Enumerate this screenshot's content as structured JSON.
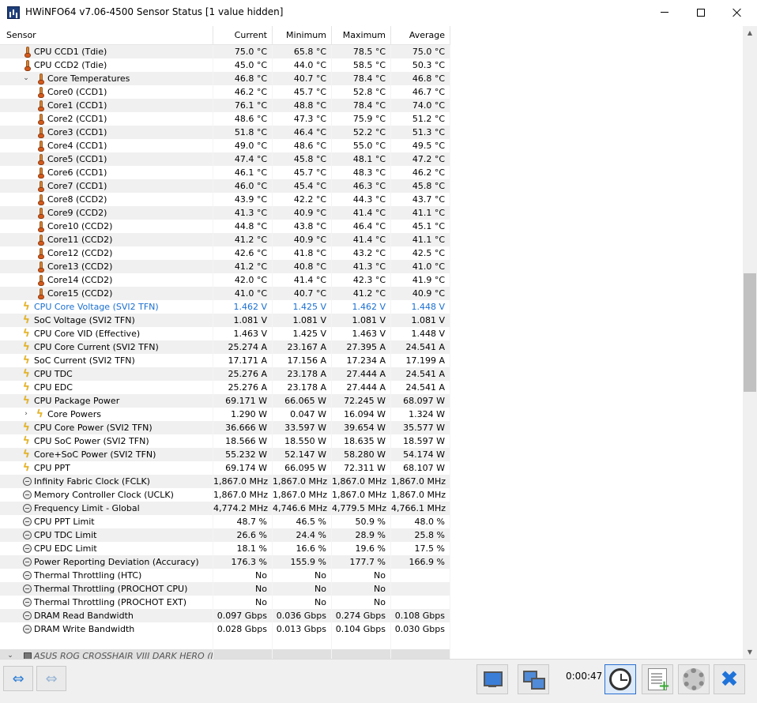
{
  "window": {
    "title": "HWiNFO64 v7.06-4500 Sensor Status [1 value hidden]"
  },
  "columns": {
    "sensor": "Sensor",
    "current": "Current",
    "minimum": "Minimum",
    "maximum": "Maximum",
    "average": "Average"
  },
  "rows": [
    {
      "icon": "thermometer",
      "indent": 1,
      "label": "CPU CCD1 (Tdie)",
      "cur": "75.0 °C",
      "min": "65.8 °C",
      "max": "78.5 °C",
      "avg": "75.0 °C"
    },
    {
      "icon": "thermometer",
      "indent": 1,
      "label": "CPU CCD2 (Tdie)",
      "cur": "45.0 °C",
      "min": "44.0 °C",
      "max": "58.5 °C",
      "avg": "50.3 °C"
    },
    {
      "icon": "thermometer",
      "indent": 2,
      "expander": "v",
      "label": "Core Temperatures",
      "cur": "46.8 °C",
      "min": "40.7 °C",
      "max": "78.4 °C",
      "avg": "46.8 °C"
    },
    {
      "icon": "thermometer",
      "indent": 2,
      "label": "Core0 (CCD1)",
      "cur": "46.2 °C",
      "min": "45.7 °C",
      "max": "52.8 °C",
      "avg": "46.7 °C"
    },
    {
      "icon": "thermometer",
      "indent": 2,
      "label": "Core1 (CCD1)",
      "cur": "76.1 °C",
      "min": "48.8 °C",
      "max": "78.4 °C",
      "avg": "74.0 °C"
    },
    {
      "icon": "thermometer",
      "indent": 2,
      "label": "Core2 (CCD1)",
      "cur": "48.6 °C",
      "min": "47.3 °C",
      "max": "75.9 °C",
      "avg": "51.2 °C"
    },
    {
      "icon": "thermometer",
      "indent": 2,
      "label": "Core3 (CCD1)",
      "cur": "51.8 °C",
      "min": "46.4 °C",
      "max": "52.2 °C",
      "avg": "51.3 °C"
    },
    {
      "icon": "thermometer",
      "indent": 2,
      "label": "Core4 (CCD1)",
      "cur": "49.0 °C",
      "min": "48.6 °C",
      "max": "55.0 °C",
      "avg": "49.5 °C"
    },
    {
      "icon": "thermometer",
      "indent": 2,
      "label": "Core5 (CCD1)",
      "cur": "47.4 °C",
      "min": "45.8 °C",
      "max": "48.1 °C",
      "avg": "47.2 °C"
    },
    {
      "icon": "thermometer",
      "indent": 2,
      "label": "Core6 (CCD1)",
      "cur": "46.1 °C",
      "min": "45.7 °C",
      "max": "48.3 °C",
      "avg": "46.2 °C"
    },
    {
      "icon": "thermometer",
      "indent": 2,
      "label": "Core7 (CCD1)",
      "cur": "46.0 °C",
      "min": "45.4 °C",
      "max": "46.3 °C",
      "avg": "45.8 °C"
    },
    {
      "icon": "thermometer",
      "indent": 2,
      "label": "Core8 (CCD2)",
      "cur": "43.9 °C",
      "min": "42.2 °C",
      "max": "44.3 °C",
      "avg": "43.7 °C"
    },
    {
      "icon": "thermometer",
      "indent": 2,
      "label": "Core9 (CCD2)",
      "cur": "41.3 °C",
      "min": "40.9 °C",
      "max": "41.4 °C",
      "avg": "41.1 °C"
    },
    {
      "icon": "thermometer",
      "indent": 2,
      "label": "Core10 (CCD2)",
      "cur": "44.8 °C",
      "min": "43.8 °C",
      "max": "46.4 °C",
      "avg": "45.1 °C"
    },
    {
      "icon": "thermometer",
      "indent": 2,
      "label": "Core11 (CCD2)",
      "cur": "41.2 °C",
      "min": "40.9 °C",
      "max": "41.4 °C",
      "avg": "41.1 °C"
    },
    {
      "icon": "thermometer",
      "indent": 2,
      "label": "Core12 (CCD2)",
      "cur": "42.6 °C",
      "min": "41.8 °C",
      "max": "43.2 °C",
      "avg": "42.5 °C"
    },
    {
      "icon": "thermometer",
      "indent": 2,
      "label": "Core13 (CCD2)",
      "cur": "41.2 °C",
      "min": "40.8 °C",
      "max": "41.3 °C",
      "avg": "41.0 °C"
    },
    {
      "icon": "thermometer",
      "indent": 2,
      "label": "Core14 (CCD2)",
      "cur": "42.0 °C",
      "min": "41.4 °C",
      "max": "42.3 °C",
      "avg": "41.9 °C"
    },
    {
      "icon": "thermometer",
      "indent": 2,
      "label": "Core15 (CCD2)",
      "cur": "41.0 °C",
      "min": "40.7 °C",
      "max": "41.2 °C",
      "avg": "40.9 °C"
    },
    {
      "icon": "lightning",
      "indent": 1,
      "highlight": true,
      "label": "CPU Core Voltage (SVI2 TFN)",
      "cur": "1.462 V",
      "min": "1.425 V",
      "max": "1.462 V",
      "avg": "1.448 V"
    },
    {
      "icon": "lightning",
      "indent": 1,
      "label": "SoC Voltage (SVI2 TFN)",
      "cur": "1.081 V",
      "min": "1.081 V",
      "max": "1.081 V",
      "avg": "1.081 V"
    },
    {
      "icon": "lightning",
      "indent": 1,
      "label": "CPU Core VID (Effective)",
      "cur": "1.463 V",
      "min": "1.425 V",
      "max": "1.463 V",
      "avg": "1.448 V"
    },
    {
      "icon": "lightning",
      "indent": 1,
      "label": "CPU Core Current (SVI2 TFN)",
      "cur": "25.274 A",
      "min": "23.167 A",
      "max": "27.395 A",
      "avg": "24.541 A"
    },
    {
      "icon": "lightning",
      "indent": 1,
      "label": "SoC Current (SVI2 TFN)",
      "cur": "17.171 A",
      "min": "17.156 A",
      "max": "17.234 A",
      "avg": "17.199 A"
    },
    {
      "icon": "lightning",
      "indent": 1,
      "label": "CPU TDC",
      "cur": "25.276 A",
      "min": "23.178 A",
      "max": "27.444 A",
      "avg": "24.541 A"
    },
    {
      "icon": "lightning",
      "indent": 1,
      "label": "CPU EDC",
      "cur": "25.276 A",
      "min": "23.178 A",
      "max": "27.444 A",
      "avg": "24.541 A"
    },
    {
      "icon": "lightning",
      "indent": 1,
      "label": "CPU Package Power",
      "cur": "69.171 W",
      "min": "66.065 W",
      "max": "72.245 W",
      "avg": "68.097 W"
    },
    {
      "icon": "lightning",
      "indent": 2,
      "expander": ">",
      "label": "Core Powers",
      "cur": "1.290 W",
      "min": "0.047 W",
      "max": "16.094 W",
      "avg": "1.324 W"
    },
    {
      "icon": "lightning",
      "indent": 1,
      "label": "CPU Core Power (SVI2 TFN)",
      "cur": "36.666 W",
      "min": "33.597 W",
      "max": "39.654 W",
      "avg": "35.577 W"
    },
    {
      "icon": "lightning",
      "indent": 1,
      "label": "CPU SoC Power (SVI2 TFN)",
      "cur": "18.566 W",
      "min": "18.550 W",
      "max": "18.635 W",
      "avg": "18.597 W"
    },
    {
      "icon": "lightning",
      "indent": 1,
      "label": "Core+SoC Power (SVI2 TFN)",
      "cur": "55.232 W",
      "min": "52.147 W",
      "max": "58.280 W",
      "avg": "54.174 W"
    },
    {
      "icon": "lightning",
      "indent": 1,
      "label": "CPU PPT",
      "cur": "69.174 W",
      "min": "66.095 W",
      "max": "72.311 W",
      "avg": "68.107 W"
    },
    {
      "icon": "clock",
      "indent": 1,
      "label": "Infinity Fabric Clock (FCLK)",
      "cur": "1,867.0 MHz",
      "min": "1,867.0 MHz",
      "max": "1,867.0 MHz",
      "avg": "1,867.0 MHz"
    },
    {
      "icon": "clock",
      "indent": 1,
      "label": "Memory Controller Clock (UCLK)",
      "cur": "1,867.0 MHz",
      "min": "1,867.0 MHz",
      "max": "1,867.0 MHz",
      "avg": "1,867.0 MHz"
    },
    {
      "icon": "clock",
      "indent": 1,
      "label": "Frequency Limit - Global",
      "cur": "4,774.2 MHz",
      "min": "4,746.6 MHz",
      "max": "4,779.5 MHz",
      "avg": "4,766.1 MHz"
    },
    {
      "icon": "clock",
      "indent": 1,
      "label": "CPU PPT Limit",
      "cur": "48.7 %",
      "min": "46.5 %",
      "max": "50.9 %",
      "avg": "48.0 %"
    },
    {
      "icon": "clock",
      "indent": 1,
      "label": "CPU TDC Limit",
      "cur": "26.6 %",
      "min": "24.4 %",
      "max": "28.9 %",
      "avg": "25.8 %"
    },
    {
      "icon": "clock",
      "indent": 1,
      "label": "CPU EDC Limit",
      "cur": "18.1 %",
      "min": "16.6 %",
      "max": "19.6 %",
      "avg": "17.5 %"
    },
    {
      "icon": "clock",
      "indent": 1,
      "label": "Power Reporting Deviation (Accuracy)",
      "cur": "176.3 %",
      "min": "155.9 %",
      "max": "177.7 %",
      "avg": "166.9 %"
    },
    {
      "icon": "clock",
      "indent": 1,
      "label": "Thermal Throttling (HTC)",
      "cur": "No",
      "min": "No",
      "max": "No",
      "avg": ""
    },
    {
      "icon": "clock",
      "indent": 1,
      "label": "Thermal Throttling (PROCHOT CPU)",
      "cur": "No",
      "min": "No",
      "max": "No",
      "avg": ""
    },
    {
      "icon": "clock",
      "indent": 1,
      "label": "Thermal Throttling (PROCHOT EXT)",
      "cur": "No",
      "min": "No",
      "max": "No",
      "avg": ""
    },
    {
      "icon": "clock",
      "indent": 1,
      "label": "DRAM Read Bandwidth",
      "cur": "0.097 Gbps",
      "min": "0.036 Gbps",
      "max": "0.274 Gbps",
      "avg": "0.108 Gbps"
    },
    {
      "icon": "clock",
      "indent": 1,
      "label": "DRAM Write Bandwidth",
      "cur": "0.028 Gbps",
      "min": "0.013 Gbps",
      "max": "0.104 Gbps",
      "avg": "0.030 Gbps"
    },
    {
      "spacer": true
    },
    {
      "icon": "chip",
      "indent": 1,
      "expander": "v",
      "group": true,
      "label": "ASUS ROG CROSSHAIR VIII DARK HERO (N...",
      "cur": "",
      "min": "",
      "max": "",
      "avg": ""
    }
  ],
  "statusbar": {
    "elapsed": "0:00:47"
  },
  "colors": {
    "highlight": "#1a6fd0",
    "alt_row": "#f0f0f0",
    "scroll_thumb": "#c1c1c1"
  }
}
